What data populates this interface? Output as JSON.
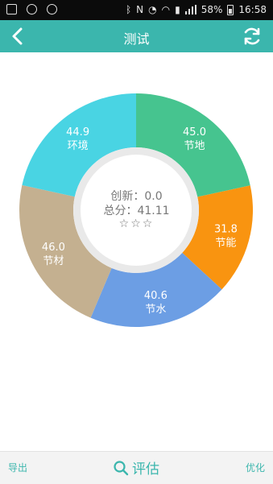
{
  "status_bar": {
    "battery": "58%",
    "time": "16:58",
    "icons": [
      "image-icon",
      "sync-icon",
      "alarm-icon",
      "bluetooth-icon",
      "nfc-icon",
      "alarm-clock-icon",
      "wifi-icon",
      "sim-icon",
      "signal-icon",
      "battery-icon"
    ]
  },
  "header": {
    "title": "测试",
    "back_icon": "chevron-left-icon",
    "refresh_icon": "refresh-icon",
    "background_color": "#3bb6ad"
  },
  "chart_data": {
    "type": "pie",
    "variant": "donut",
    "segments": [
      {
        "label": "节地",
        "value": 45.0,
        "display": "45.0",
        "color": "#46c48f"
      },
      {
        "label": "节能",
        "value": 31.8,
        "display": "31.8",
        "color": "#f99410"
      },
      {
        "label": "节水",
        "value": 40.6,
        "display": "40.6",
        "color": "#6c9ee4"
      },
      {
        "label": "节材",
        "value": 46.0,
        "display": "46.0",
        "color": "#c4b090"
      },
      {
        "label": "环境",
        "value": 44.9,
        "display": "44.9",
        "color": "#49d4e3"
      }
    ],
    "center": {
      "innovation_label": "创新：0.0",
      "total_label": "总分：41.11",
      "stars": "☆☆☆"
    }
  },
  "bottom_bar": {
    "export_label": "导出",
    "evaluate_label": "评估",
    "optimize_label": "优化",
    "evaluate_icon": "search-icon"
  }
}
